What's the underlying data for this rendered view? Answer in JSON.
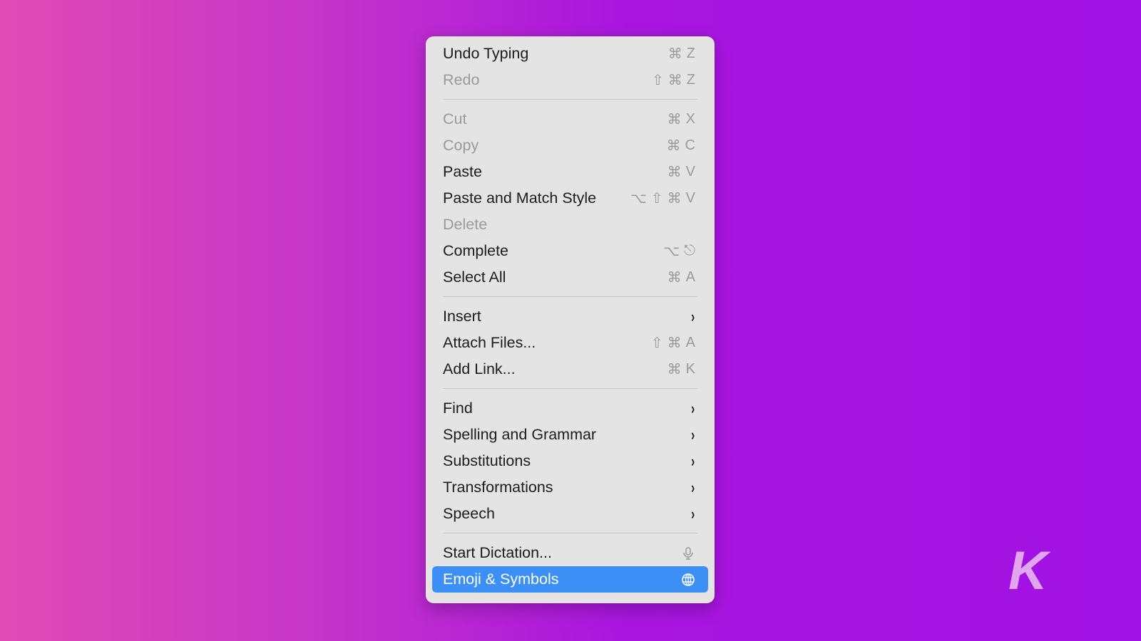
{
  "menu": {
    "groups": [
      [
        {
          "label": "Undo Typing",
          "shortcut": [
            "⌘",
            "Z"
          ],
          "disabled": false
        },
        {
          "label": "Redo",
          "shortcut": [
            "⇧",
            "⌘",
            "Z"
          ],
          "disabled": true
        }
      ],
      [
        {
          "label": "Cut",
          "shortcut": [
            "⌘",
            "X"
          ],
          "disabled": true
        },
        {
          "label": "Copy",
          "shortcut": [
            "⌘",
            "C"
          ],
          "disabled": true
        },
        {
          "label": "Paste",
          "shortcut": [
            "⌘",
            "V"
          ],
          "disabled": false
        },
        {
          "label": "Paste and Match Style",
          "shortcut": [
            "⌥",
            "⇧",
            "⌘",
            "V"
          ],
          "disabled": false
        },
        {
          "label": "Delete",
          "shortcut": [],
          "disabled": true
        },
        {
          "label": "Complete",
          "shortcut": [
            "⌥",
            "⎋"
          ],
          "disabled": false
        },
        {
          "label": "Select All",
          "shortcut": [
            "⌘",
            "A"
          ],
          "disabled": false
        }
      ],
      [
        {
          "label": "Insert",
          "submenu": true
        },
        {
          "label": "Attach Files...",
          "shortcut": [
            "⇧",
            "⌘",
            "A"
          ],
          "disabled": false
        },
        {
          "label": "Add Link...",
          "shortcut": [
            "⌘",
            "K"
          ],
          "disabled": false
        }
      ],
      [
        {
          "label": "Find",
          "submenu": true
        },
        {
          "label": "Spelling and Grammar",
          "submenu": true
        },
        {
          "label": "Substitutions",
          "submenu": true
        },
        {
          "label": "Transformations",
          "submenu": true
        },
        {
          "label": "Speech",
          "submenu": true
        }
      ],
      [
        {
          "label": "Start Dictation...",
          "icon": "microphone-icon"
        },
        {
          "label": "Emoji & Symbols",
          "icon": "globe-icon",
          "selected": true
        }
      ]
    ],
    "chevron_glyph": "›"
  },
  "colors": {
    "selected": "#3b8ff5",
    "logo": "#e2a6f0"
  },
  "logo": {
    "letter": "K"
  }
}
